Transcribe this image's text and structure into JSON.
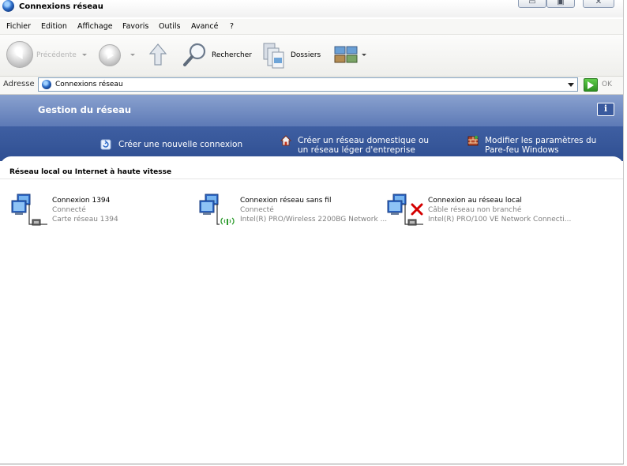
{
  "window": {
    "title": "Connexions réseau"
  },
  "menu": {
    "items": [
      "Fichier",
      "Edition",
      "Affichage",
      "Favoris",
      "Outils",
      "Avancé",
      "?"
    ]
  },
  "toolbar": {
    "back_label": "Précédente",
    "search_label": "Rechercher",
    "folders_label": "Dossiers"
  },
  "address": {
    "label": "Adresse",
    "value": "Connexions réseau",
    "go_label": "OK"
  },
  "tasks": {
    "title": "Gestion du réseau",
    "info_label": "i",
    "items": [
      {
        "line1": "Créer une nouvelle connexion",
        "line2": ""
      },
      {
        "line1": "Créer un réseau domestique ou",
        "line2": "un réseau léger d'entreprise"
      },
      {
        "line1": "Modifier les paramètres du",
        "line2": "Pare-feu Windows"
      }
    ]
  },
  "group": {
    "title": "Réseau local ou Internet à haute vitesse"
  },
  "connections": [
    {
      "name": "Connexion 1394",
      "status": "Connecté",
      "device": "Carte réseau 1394"
    },
    {
      "name": "Connexion réseau sans fil",
      "status": "Connecté",
      "device": "Intel(R) PRO/Wireless 2200BG Network ..."
    },
    {
      "name": "Connexion au réseau local",
      "status": "Câble réseau non branché",
      "device": "Intel(R) PRO/100 VE Network Connecti..."
    }
  ],
  "colors": {
    "task_band": "#4a6aa8",
    "link_text": "#ffffff",
    "status_text": "#808080",
    "error_x": "#d40000"
  }
}
